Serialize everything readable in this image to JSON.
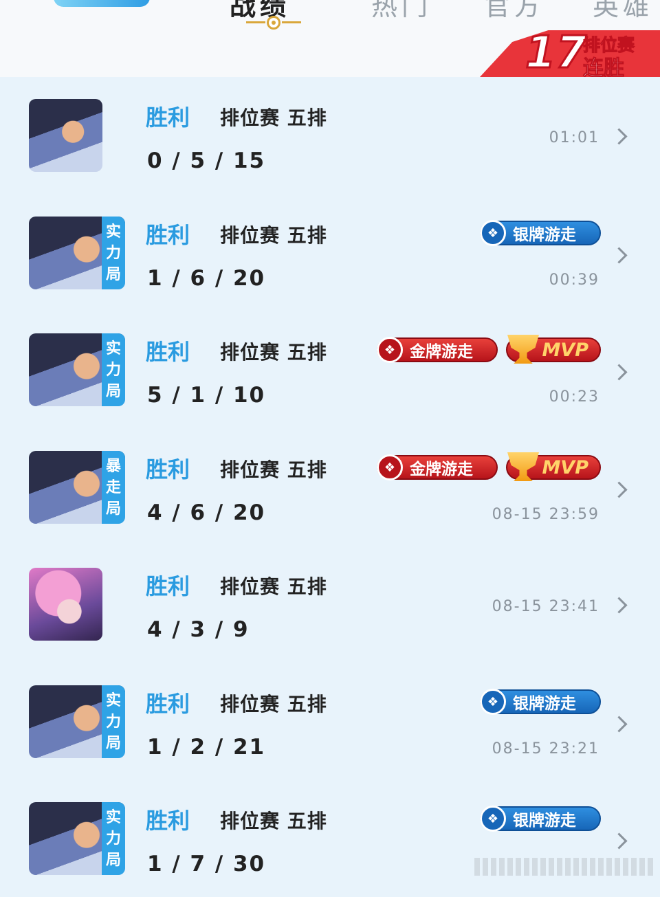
{
  "header": {
    "tabs": [
      {
        "label": "战绩",
        "active": true
      },
      {
        "label": "热门",
        "active": false
      },
      {
        "label": "官方",
        "active": false
      },
      {
        "label": "英雄",
        "active": false
      }
    ],
    "streak": {
      "number": "17",
      "line1": "排位赛",
      "line2": "连胜"
    }
  },
  "matches": [
    {
      "result": "胜利",
      "mode": "排位赛 五排",
      "kda": "0 / 5 / 15",
      "time": "01:01",
      "tag": null,
      "avatar": "male",
      "badges": []
    },
    {
      "result": "胜利",
      "mode": "排位赛 五排",
      "kda": "1 / 6 / 20",
      "time": "00:39",
      "tag": "实力局",
      "avatar": "male",
      "badges": [
        {
          "type": "silver",
          "label": "银牌游走"
        }
      ]
    },
    {
      "result": "胜利",
      "mode": "排位赛 五排",
      "kda": "5 / 1 / 10",
      "time": "00:23",
      "tag": "实力局",
      "avatar": "male",
      "badges": [
        {
          "type": "gold",
          "label": "金牌游走"
        },
        {
          "type": "mvp",
          "label": "MVP"
        }
      ]
    },
    {
      "result": "胜利",
      "mode": "排位赛 五排",
      "kda": "4 / 6 / 20",
      "time": "08-15 23:59",
      "tag": "暴走局",
      "avatar": "male",
      "badges": [
        {
          "type": "gold",
          "label": "金牌游走"
        },
        {
          "type": "mvp",
          "label": "MVP"
        }
      ]
    },
    {
      "result": "胜利",
      "mode": "排位赛 五排",
      "kda": "4 / 3 / 9",
      "time": "08-15 23:41",
      "tag": null,
      "avatar": "female",
      "badges": []
    },
    {
      "result": "胜利",
      "mode": "排位赛 五排",
      "kda": "1 / 2 / 21",
      "time": "08-15 23:21",
      "tag": "实力局",
      "avatar": "male",
      "badges": [
        {
          "type": "silver",
          "label": "银牌游走"
        }
      ]
    },
    {
      "result": "胜利",
      "mode": "排位赛 五排",
      "kda": "1 / 7 / 30",
      "time": "",
      "tag": "实力局",
      "avatar": "male",
      "badges": [
        {
          "type": "silver",
          "label": "银牌游走"
        }
      ]
    }
  ],
  "colors": {
    "background": "#e8f3fb",
    "result": "#2a9be0",
    "silver_badge": "#1766b8",
    "gold_badge": "#b7141b",
    "streak_banner": "#e8343a"
  }
}
